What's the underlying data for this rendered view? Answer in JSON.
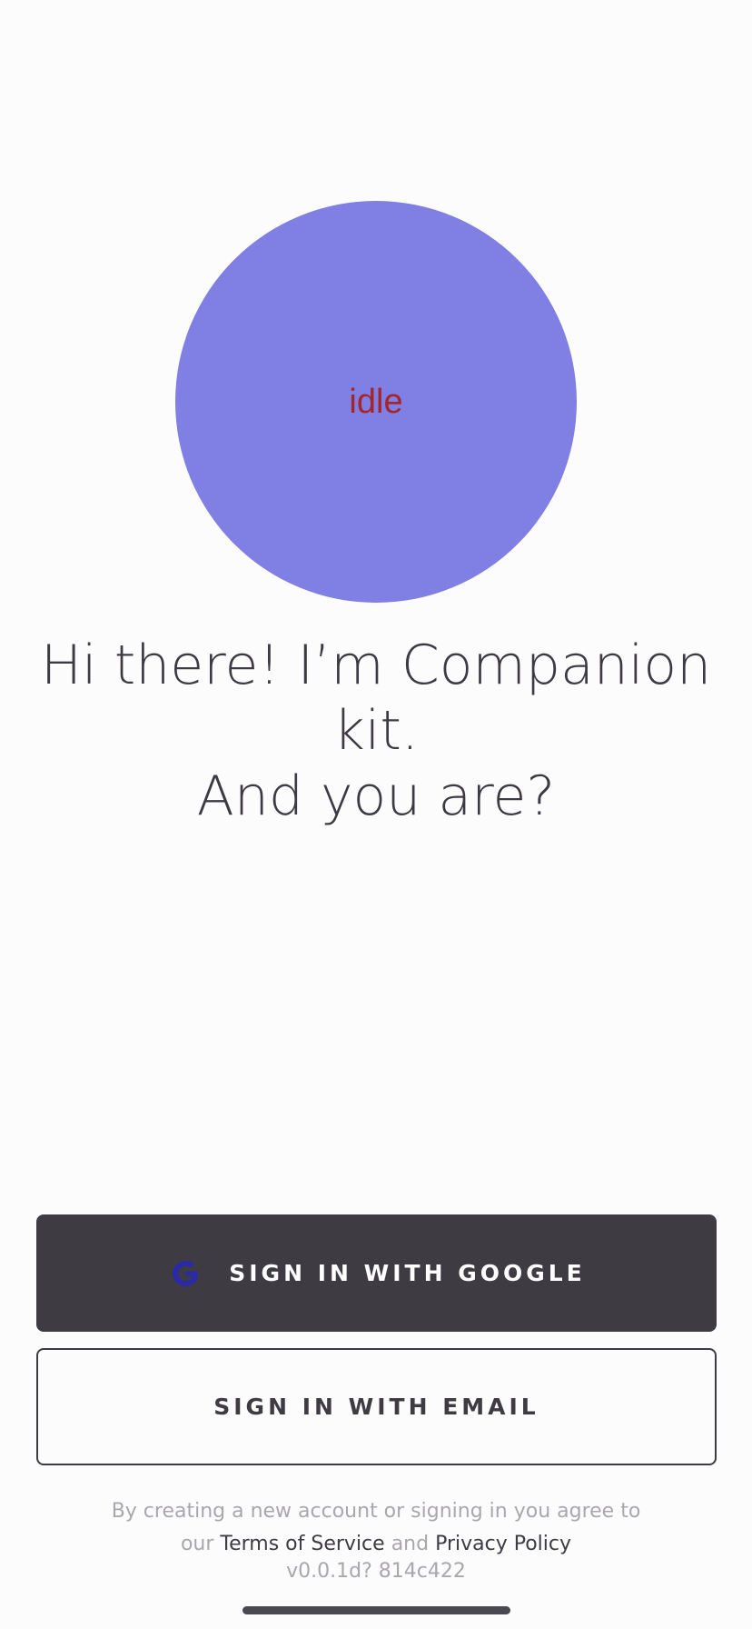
{
  "avatar": {
    "status": "idle",
    "color": "#7f7fe4",
    "status_color": "#a3262a"
  },
  "greeting": {
    "line1": "Hi there! I’m Companion",
    "line2": "kit.",
    "line3": "And you are?"
  },
  "buttons": {
    "google_label": "SIGN IN WITH GOOGLE",
    "google_icon": "google-g-icon",
    "email_label": "SIGN IN WITH EMAIL"
  },
  "legal": {
    "line1": "By creating a new account or signing in you agree to",
    "prefix": "our",
    "terms": "Terms of Service",
    "and": "and",
    "privacy": "Privacy Policy"
  },
  "version": "v0.0.1d? 814c422",
  "colors": {
    "primary_dark": "#3e3b43",
    "background": "#fdfcfd",
    "muted_text": "#a9a6ad",
    "google_icon": "#2b2aa6"
  }
}
